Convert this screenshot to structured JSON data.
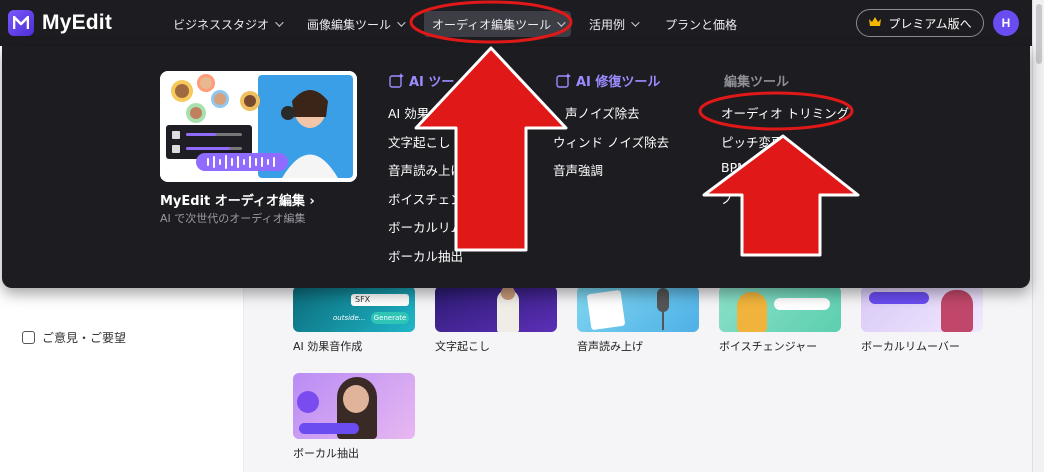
{
  "header": {
    "logo_text": "MyEdit",
    "nav": [
      {
        "label": "ビジネススタジオ"
      },
      {
        "label": "画像編集ツール"
      },
      {
        "label": "オーディオ編集ツール"
      },
      {
        "label": "活用例"
      },
      {
        "label": "プランと価格"
      }
    ],
    "premium_label": "プレミアム版へ",
    "avatar_initial": "H"
  },
  "mega_menu": {
    "feature": {
      "title": "MyEdit オーディオ編集 ›",
      "subtitle": "AI で次世代のオーディオ編集"
    },
    "columns": [
      {
        "heading": "AI ツー",
        "items": [
          "AI 効果",
          "文字起こし",
          "音声読み上げ",
          "ボイスチェンジャー",
          "ボーカルリムーバー",
          "ボーカル抽出"
        ]
      },
      {
        "heading": "AI 修復ツール",
        "items": [
          "声ノイズ除去",
          "ウィンド ノイズ除去",
          "音声強調"
        ]
      },
      {
        "heading": "編集ツール",
        "items": [
          "オーディオ トリミング",
          "ピッチ変更",
          "BPM",
          "ノ"
        ]
      }
    ]
  },
  "page": {
    "feedback_label": "ご意見・ご要望",
    "cards": [
      {
        "label": "AI 効果音作成"
      },
      {
        "label": "文字起こし"
      },
      {
        "label": "音声読み上げ"
      },
      {
        "label": "ボイスチェンジャー"
      },
      {
        "label": "ボーカルリムーバー"
      },
      {
        "label": "ボーカル抽出"
      }
    ],
    "thumb_text": {
      "sfx": "SFX",
      "sfx_prompt": "outside...",
      "generate": "Generate"
    }
  },
  "colors": {
    "accent": "#7b56ff",
    "annotation_red": "#e01818",
    "menu_bg": "#1c1c21",
    "ai_heading": "#9b8cff"
  }
}
